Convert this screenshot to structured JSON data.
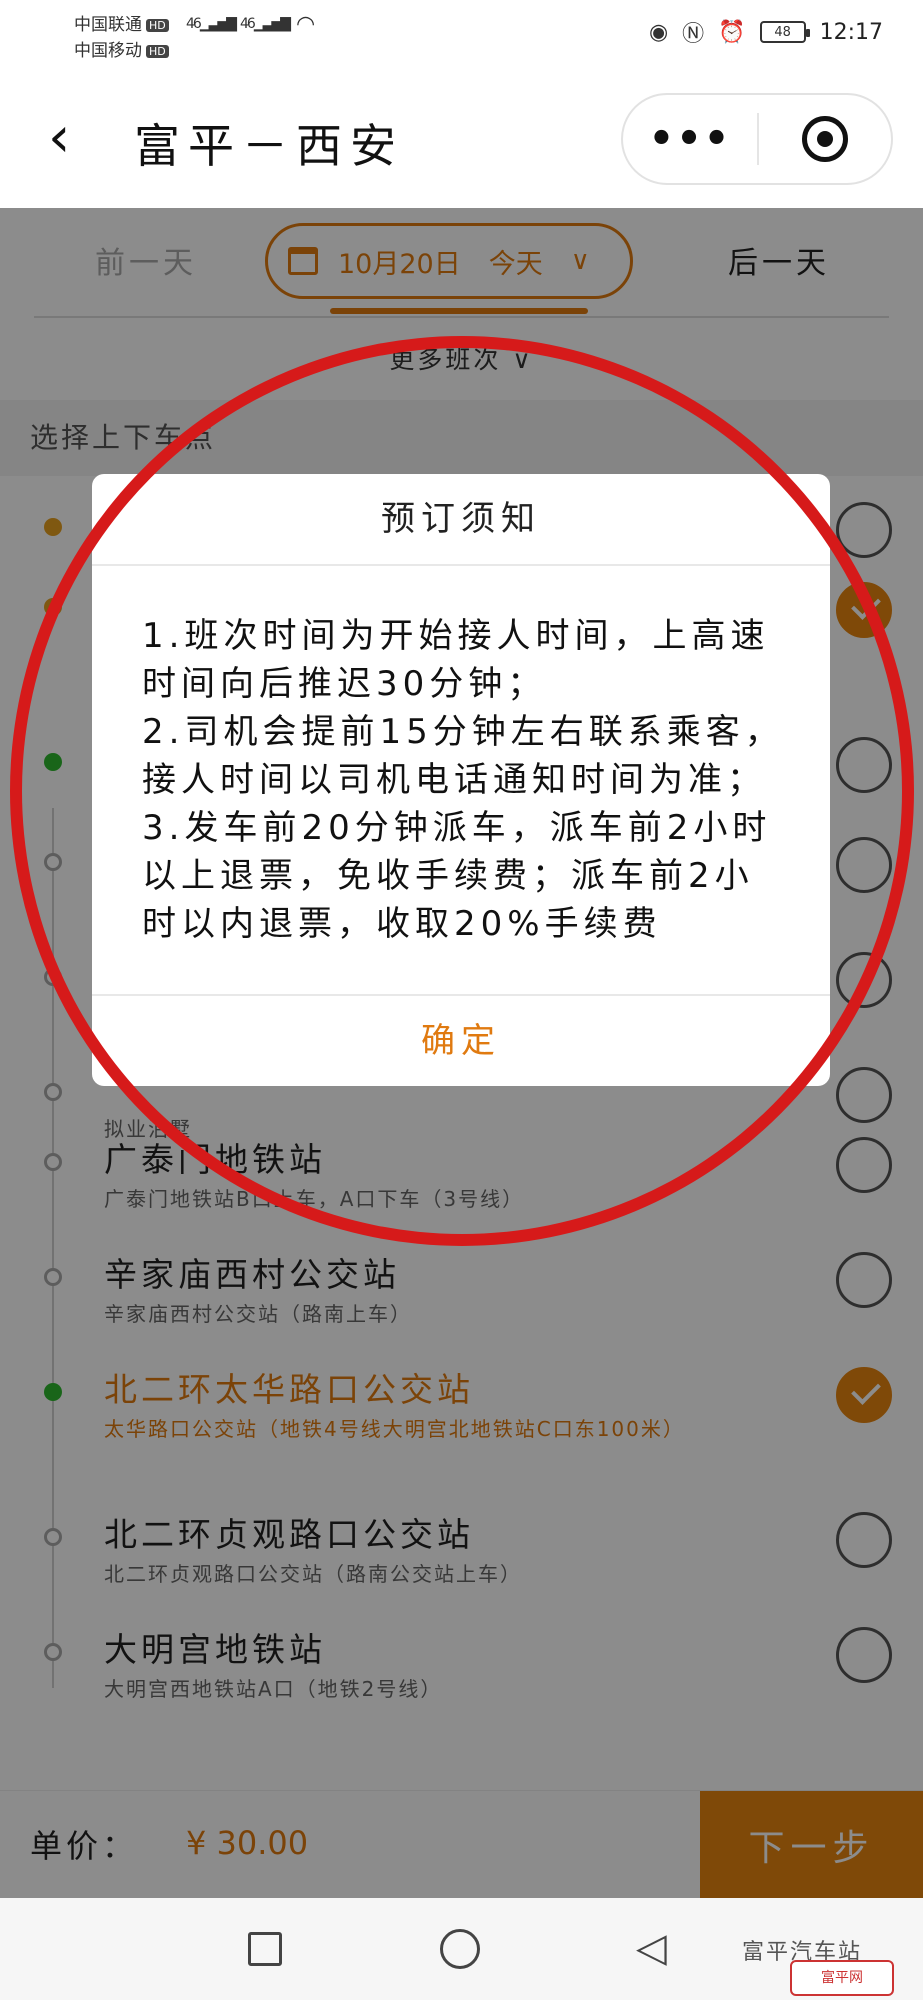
{
  "status_bar": {
    "carrier1": "中国联通",
    "carrier2": "中国移动",
    "hd": "HD",
    "net": "46",
    "battery": "48",
    "time": "12:17"
  },
  "header": {
    "back_icon": "‹",
    "title": "富平－西安",
    "more_icon": "•••"
  },
  "date_bar": {
    "prev": "前一天",
    "date": "10月20日",
    "today": "今天",
    "next": "后一天"
  },
  "more_trips": "更多班次 ∨",
  "section_label": "选择上下车点",
  "stops": [
    {
      "name": "",
      "desc": "",
      "selected": false,
      "dot": "orange",
      "checked": false
    },
    {
      "name": "",
      "desc": "",
      "selected": false,
      "dot": "orange",
      "checked": true
    },
    {
      "name": "",
      "desc": "",
      "selected": false,
      "dot": "green",
      "checked": false
    },
    {
      "name": "",
      "desc": "",
      "selected": false,
      "dot": "hollow",
      "checked": false
    },
    {
      "name": "",
      "desc": "",
      "selected": false,
      "dot": "hollow",
      "checked": false
    },
    {
      "name": "",
      "desc": "拟业泊墅",
      "selected": false,
      "dot": "hollow",
      "checked": false
    },
    {
      "name": "广泰门地铁站",
      "desc": "广泰门地铁站B口上车，A口下车（3号线）",
      "selected": false,
      "dot": "hollow",
      "checked": false
    },
    {
      "name": "辛家庙西村公交站",
      "desc": "辛家庙西村公交站（路南上车）",
      "selected": false,
      "dot": "hollow",
      "checked": false
    },
    {
      "name": "北二环太华路口公交站",
      "desc": "太华路口公交站（地铁4号线大明宫北地铁站C口东100米）",
      "selected": true,
      "dot": "green",
      "checked": true
    },
    {
      "name": "北二环贞观路口公交站",
      "desc": "北二环贞观路口公交站（路南公交站上车）",
      "selected": false,
      "dot": "hollow",
      "checked": false
    },
    {
      "name": "大明宫地铁站",
      "desc": "大明宫西地铁站A口（地铁2号线）",
      "selected": false,
      "dot": "hollow",
      "checked": false
    }
  ],
  "price": {
    "label": "单价：",
    "value": "¥ 30.00",
    "next_label": "下一步"
  },
  "modal": {
    "title": "预订须知",
    "lines": [
      "1.班次时间为开始接人时间，上高速时间向后推迟30分钟；",
      "2.司机会提前15分钟左右联系乘客，接人时间以司机电话通知时间为准；",
      "3.发车前20分钟派车，派车前2小时以上退票，免收手续费；派车前2小时以内退票，收取20%手续费"
    ],
    "confirm": "确定"
  },
  "watermark": {
    "text": "富平汽车站",
    "logo": "富平网"
  },
  "colors": {
    "accent": "#e8860f",
    "annotation": "#d61a1a",
    "green": "#2eb82e"
  }
}
